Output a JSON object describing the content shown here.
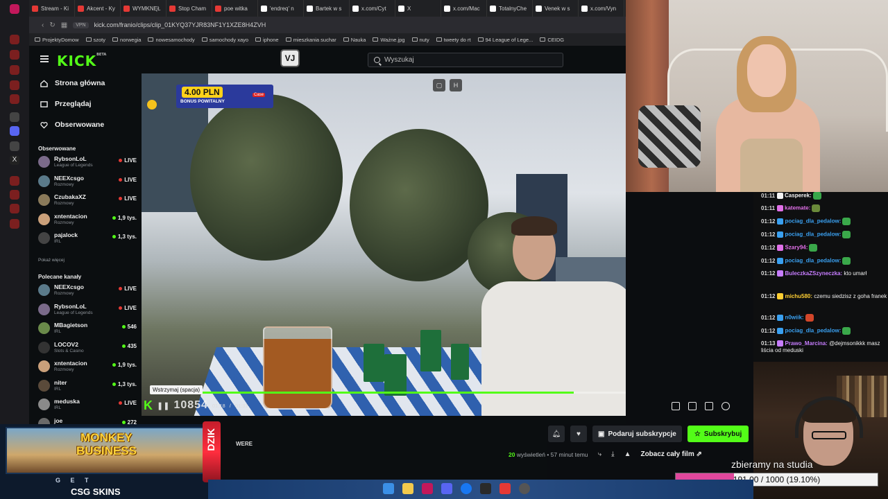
{
  "browser": {
    "tabs": [
      {
        "label": "Stream - Ki",
        "color": "#e53935"
      },
      {
        "label": "Akcent - Ky",
        "color": "#e53935"
      },
      {
        "label": "WYMKNĘŁ",
        "color": "#e53935"
      },
      {
        "label": "Stop Cham",
        "color": "#e53935"
      },
      {
        "label": "poe witka",
        "color": "#e53935"
      },
      {
        "label": "'endreq' n",
        "color": "#ffffff"
      },
      {
        "label": "Bartek w s",
        "color": "#ffffff"
      },
      {
        "label": "x.com/Cyt",
        "color": "#ffffff"
      },
      {
        "label": "X",
        "color": "#ffffff"
      },
      {
        "label": "x.com/Mac",
        "color": "#ffffff"
      },
      {
        "label": "TotalnyChe",
        "color": "#ffffff"
      },
      {
        "label": "Venek w s",
        "color": "#ffffff"
      },
      {
        "label": "x.com/Vyn",
        "color": "#ffffff"
      }
    ],
    "vpn_badge": "VPN",
    "url": "kick.com/franio/clips/clip_01KYQ37YJR83NF1Y1XZE8H4ZVH",
    "bookmarks": [
      "ProjektyDomow",
      "szoty",
      "norwegia",
      "nowesamochody",
      "samochody xayo",
      "iphone",
      "mieszkania suchar",
      "Nauka",
      "Ważne.jpg",
      "nuty",
      "tweety do rt",
      "94 League of Lege...",
      "CEIDG"
    ]
  },
  "site": {
    "logo": "KICK",
    "logo_beta": "BETA",
    "vj_button": "VJ",
    "search_placeholder": "Wyszukaj",
    "nav": [
      {
        "label": "Strona główna"
      },
      {
        "label": "Przeglądaj"
      },
      {
        "label": "Obserwowane"
      }
    ],
    "followed_title": "Obserwowane",
    "followed": [
      {
        "name": "RybsonLoL",
        "category": "League of Legends",
        "viewers": "LIVE",
        "avatar": "#7a6a8a"
      },
      {
        "name": "NEEXcsgo",
        "category": "Rozmowy",
        "viewers": "LIVE",
        "avatar": "#5a7a8a"
      },
      {
        "name": "CzubakaXZ",
        "category": "Rozmowy",
        "viewers": "LIVE",
        "avatar": "#8a7a5a"
      },
      {
        "name": "xntentacion",
        "category": "Rozmowy",
        "viewers": "1,9 tys.",
        "avatar": "#caa07a"
      },
      {
        "name": "pajalock",
        "category": "IRL",
        "viewers": "1,3 tys.",
        "avatar": "#444444"
      }
    ],
    "show_more": "Pokaż więcej",
    "recommended_title": "Polecane kanały",
    "recommended": [
      {
        "name": "NEEXcsgo",
        "category": "Rozmowy",
        "viewers": "LIVE",
        "avatar": "#5a7a8a"
      },
      {
        "name": "RybsonLoL",
        "category": "League of Legends",
        "viewers": "LIVE",
        "avatar": "#7a6a8a"
      },
      {
        "name": "MBagietson",
        "category": "IRL",
        "viewers": "546",
        "avatar": "#6a8a4a"
      },
      {
        "name": "LOCOV2",
        "category": "Slots & Casino",
        "viewers": "435",
        "avatar": "#333333"
      },
      {
        "name": "xntentacion",
        "category": "Rozmowy",
        "viewers": "1,9 tys.",
        "avatar": "#caa07a"
      },
      {
        "name": "niter",
        "category": "IRL",
        "viewers": "1,3 tys.",
        "avatar": "#5a4a3a"
      },
      {
        "name": "meduska",
        "category": "IRL",
        "viewers": "LIVE",
        "avatar": "#8a8a8a"
      },
      {
        "name": "joe",
        "category": "",
        "viewers": "272",
        "avatar": "#6a6a6a"
      }
    ]
  },
  "video": {
    "promo_amount": "4.00 PLN",
    "promo_label": "BONUS POWITALNY",
    "promo_brand": "Case",
    "pip_icons": [
      "screen-icon",
      "h-icon"
    ],
    "tooltip": "Wstrzymaj (spacja)",
    "time_current": "01:18",
    "time_total": "01:31",
    "clock_overlay": "10854",
    "progress": 0.89
  },
  "actions": {
    "gift_label": "Podaruj subskrypcje",
    "subscribe_label": "Subskrybuj",
    "views_count": "20",
    "views_label": "wyświetleń",
    "posted": "57 minut temu",
    "full_film": "Zobacz cały film"
  },
  "chat": [
    {
      "time": "01:11",
      "user": "Casperek:",
      "color": "#f4f4f4",
      "text": "",
      "emote": "#3aa84a"
    },
    {
      "time": "01:11",
      "user": "katemate:",
      "color": "#e070e8",
      "text": "",
      "emote": "#6a8a3a"
    },
    {
      "time": "01:12",
      "user": "pociag_dla_pedalow:",
      "color": "#3aa0f0",
      "text": "",
      "emote": "#3aa84a"
    },
    {
      "time": "01:12",
      "user": "pociag_dla_pedalow:",
      "color": "#3aa0f0",
      "text": "",
      "emote": "#3aa84a"
    },
    {
      "time": "01:12",
      "user": "Szary94:",
      "color": "#e070e8",
      "text": "",
      "emote": "#3aa84a"
    },
    {
      "time": "01:12",
      "user": "pociag_dla_pedalow:",
      "color": "#3aa0f0",
      "text": "",
      "emote": "#3aa84a"
    },
    {
      "time": "01:12",
      "user": "BuleczkaZSzyneczka:",
      "color": "#c77dff",
      "text": "kto umarł",
      "emote": ""
    },
    {
      "time": "01:12",
      "user": "michu580:",
      "color": "#ffcf33",
      "text": "czemu siedzisz z goha franek",
      "emote": ""
    },
    {
      "time": "01:12",
      "user": "n0wiik:",
      "color": "#3aa0f0",
      "text": "",
      "emote": "#d2462a"
    },
    {
      "time": "01:12",
      "user": "pociag_dla_pedalow:",
      "color": "#3aa0f0",
      "text": "",
      "emote": "#3aa84a"
    },
    {
      "time": "01:13",
      "user": "Prawo_Marcina:",
      "color": "#c77dff",
      "text": "@dejmsonikkk masz liścia od meduski",
      "emote": ""
    }
  ],
  "goal": {
    "title": "zbieramy na studia",
    "label": "191.00 / 1000 (19.10%)",
    "fraction": 0.191
  },
  "ad": {
    "game_line1": "MONKEY",
    "game_line2": "BUSINESS",
    "get": "G E T",
    "brand": "CSG SKINS",
    "energy": "DZIK",
    "partial_text": "WERE"
  },
  "colors": {
    "kick_green": "#53fc18",
    "live_red": "#e53935",
    "goal_pink": "#e0479c"
  }
}
